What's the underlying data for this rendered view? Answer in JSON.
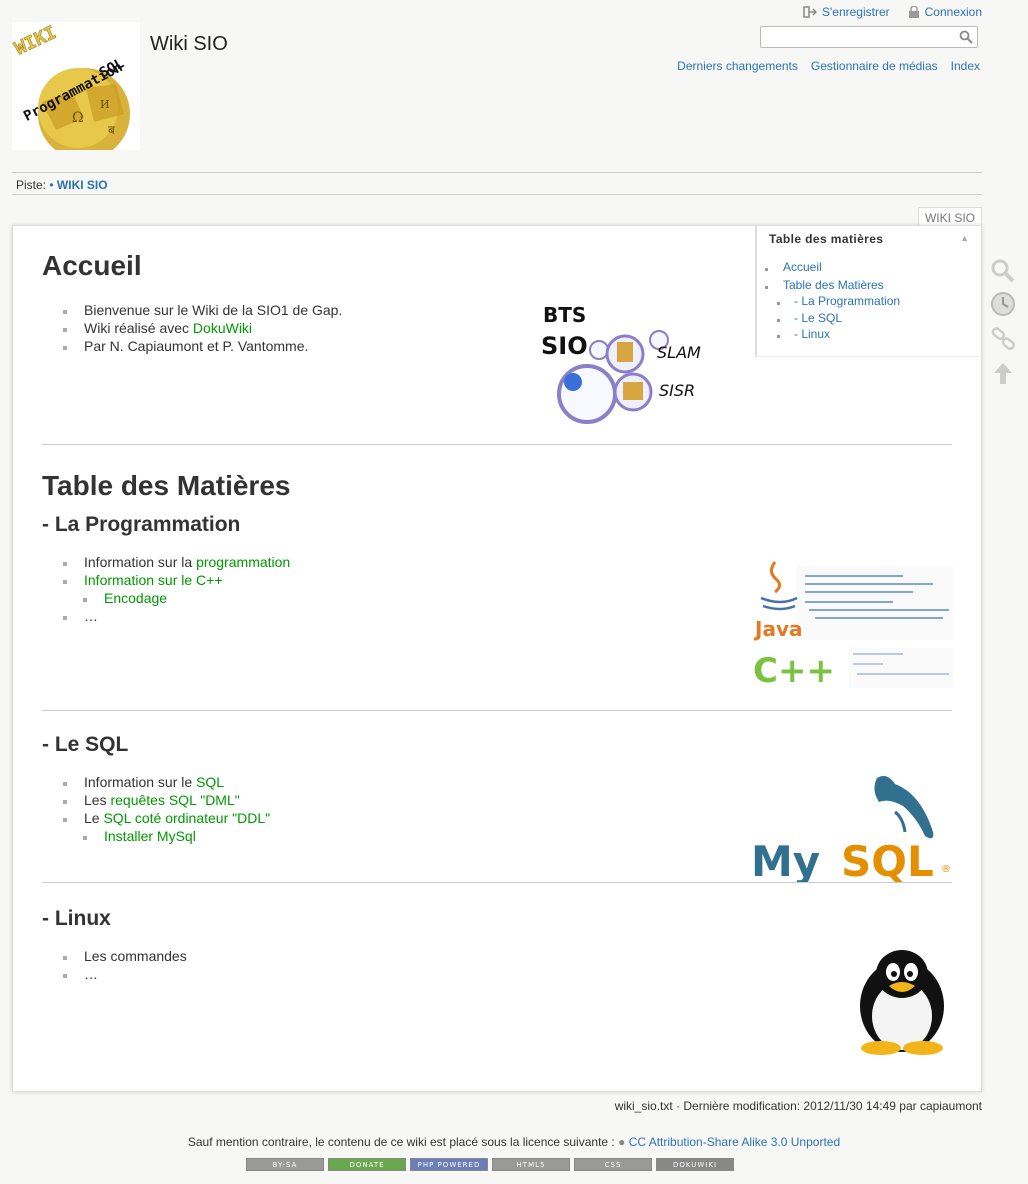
{
  "site": {
    "title": "Wiki SIO"
  },
  "user_tools": {
    "register": "S'enregistrer",
    "login": "Connexion"
  },
  "search": {
    "value": ""
  },
  "site_tools": {
    "recent": "Derniers changements",
    "media": "Gestionnaire de médias",
    "index": "Index"
  },
  "logo": {
    "line1": "WIKI",
    "line2": "Programmation",
    "line3": "SQL"
  },
  "breadcrumb": {
    "label": "Piste:",
    "sep": "•",
    "item": "WIKI SIO"
  },
  "page": {
    "id": "WIKI SIO",
    "toc": {
      "title": "Table des matières",
      "toggle": "▲",
      "items": [
        {
          "label": "Accueil"
        },
        {
          "label": "Table des Matières"
        },
        {
          "label": "- La Programmation"
        },
        {
          "label": "- Le SQL"
        },
        {
          "label": "- Linux"
        }
      ]
    },
    "accueil": {
      "heading": "Accueil",
      "items": [
        {
          "text": "Bienvenue sur le Wiki de la SIO1 de Gap."
        },
        {
          "pre": "Wiki réalisé avec ",
          "link": "DokuWiki"
        },
        {
          "text": "Par N. Capiaumont et P. Vantomme."
        }
      ],
      "bts_image": {
        "line1": "BTS",
        "line2": "SIO",
        "slam": "SLAM",
        "sisr": "SISR"
      }
    },
    "toc_section": {
      "heading": "Table des Matières"
    },
    "programmation": {
      "heading": "- La Programmation",
      "items": [
        {
          "pre": "Information sur la ",
          "link": "programmation"
        },
        {
          "link": "Information sur le C++"
        },
        {
          "link": "Encodage"
        },
        {
          "text": "…"
        }
      ],
      "java_label": "Java",
      "cpp_label": "C++"
    },
    "sql": {
      "heading": "- Le SQL",
      "items": [
        {
          "pre": "Information sur le ",
          "link": "SQL"
        },
        {
          "pre": "Les ",
          "link": "requêtes SQL \"DML\""
        },
        {
          "pre": "Le ",
          "link": "SQL coté ordinateur \"DDL\""
        },
        {
          "link": "Installer MySql"
        }
      ],
      "logo": {
        "my": "My",
        "sql": "SQL",
        "reg": "®"
      }
    },
    "linux": {
      "heading": "- Linux",
      "items": [
        {
          "text": "Les commandes"
        },
        {
          "text": "…"
        }
      ]
    }
  },
  "footer": {
    "doc_info": "wiki_sio.txt · Dernière modification: 2012/11/30 14:49 par capiaumont",
    "license_text": "Sauf mention contraire, le contenu de ce wiki est placé sous la licence suivante :",
    "license_link": "CC Attribution-Share Alike 3.0 Unported",
    "badges": [
      "BY-SA",
      "DONATE",
      "PHP POWERED",
      "HTML5",
      "CSS",
      "DOKUWIKI"
    ]
  },
  "colors": {
    "link": "#2b73b7",
    "wiki_link": "#009900"
  }
}
